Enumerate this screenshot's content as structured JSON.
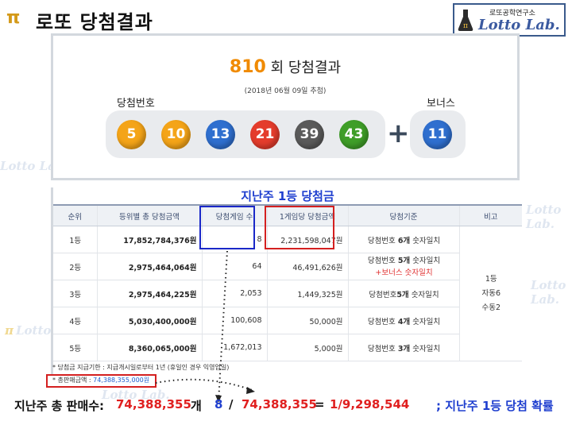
{
  "header": {
    "title": "로또 당첨결과",
    "logo_sub": "로또공학연구소",
    "logo_main": "Lotto Lab."
  },
  "watermark": "Lotto Lab.",
  "result": {
    "draw_no": "810",
    "draw_suffix": "회 당첨결과",
    "date": "(2018년 06월 09일 추첨)",
    "label_numbers": "당첨번호",
    "label_bonus": "보너스",
    "numbers": [
      "5",
      "10",
      "13",
      "21",
      "39",
      "43"
    ],
    "ball_colors": [
      "#f4a418",
      "#f4a418",
      "#2f6fcf",
      "#e43c2c",
      "#5a5a5a",
      "#3f9e28"
    ],
    "bonus": "11",
    "bonus_color": "#2f6fcf",
    "plus": "+"
  },
  "table": {
    "caption": "지난주 1등 당첨금",
    "headers": [
      "순위",
      "등위별 총 당첨금액",
      "당첨게임 수",
      "1게임당 당첨금액",
      "당첨기준",
      "비고"
    ],
    "rows": [
      {
        "rank": "1등",
        "total": "17,852,784,376원",
        "games": "8",
        "per_game": "2,231,598,047원",
        "crit_a": "당첨번호 ",
        "crit_b": "6개",
        "crit_c": " 숫자일치",
        "crit_d": ""
      },
      {
        "rank": "2등",
        "total": "2,975,464,064원",
        "games": "64",
        "per_game": "46,491,626원",
        "crit_a": "당첨번호 ",
        "crit_b": "5개",
        "crit_c": " 숫자일치",
        "crit_d": "+보너스 숫자일치"
      },
      {
        "rank": "3등",
        "total": "2,975,464,225원",
        "games": "2,053",
        "per_game": "1,449,325원",
        "crit_a": "당첨번호",
        "crit_b": "5개",
        "crit_c": " 숫자일치",
        "crit_d": ""
      },
      {
        "rank": "4등",
        "total": "5,030,400,000원",
        "games": "100,608",
        "per_game": "50,000원",
        "crit_a": "당첨번호 ",
        "crit_b": "4개",
        "crit_c": " 숫자일치",
        "crit_d": ""
      },
      {
        "rank": "5등",
        "total": "8,360,065,000원",
        "games": "1,672,013",
        "per_game": "5,000원",
        "crit_a": "당첨번호 ",
        "crit_b": "3개",
        "crit_c": " 숫자일치",
        "crit_d": ""
      }
    ],
    "remarks": [
      "1등",
      "자동6",
      "수동2"
    ],
    "note_1": "* 당첨금 지급기한 : 지급개시일로부터 1년 (휴일인 경우 익영업일)",
    "note_2_label": "* 총판매금액 : ",
    "note_2_value": "74,388,355,000원"
  },
  "bottom": {
    "label": "지난주 총 판매수: ",
    "sales": "74,388,355",
    "unit": " 개",
    "wins": "8",
    "slash": "/",
    "sales2": "74,388,355",
    "eq": "=",
    "prob": "1/9,298,544",
    "tail": "; 지난주 1등 당첨 확률"
  }
}
